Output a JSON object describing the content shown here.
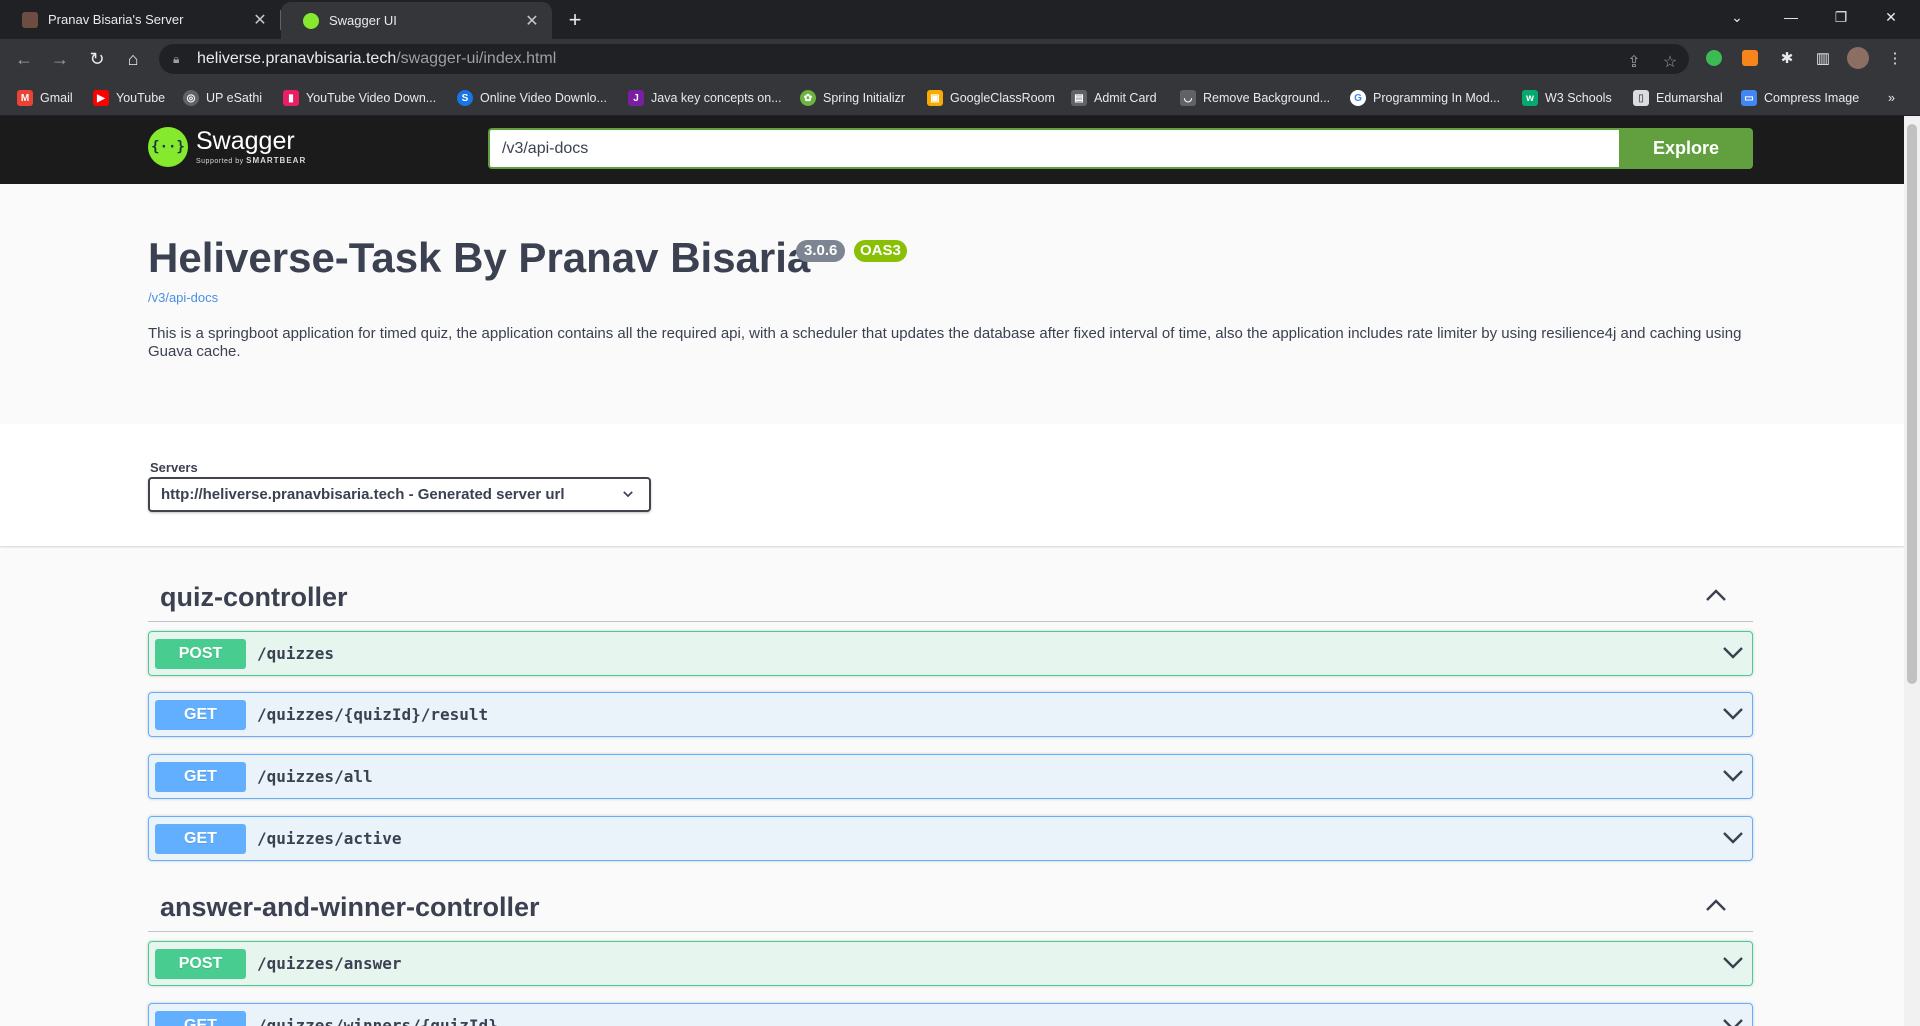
{
  "browser": {
    "tabs": [
      {
        "title": "Pranav Bisaria's Server",
        "active": false
      },
      {
        "title": "Swagger UI",
        "active": true
      }
    ],
    "url_host": "heliverse.pranavbisaria.tech",
    "url_path": "/swagger-ui/index.html",
    "bookmarks": [
      {
        "label": "Gmail",
        "icon": "gmail-icon",
        "color": "#ea4335"
      },
      {
        "label": "YouTube",
        "icon": "youtube-icon",
        "color": "#ff0000"
      },
      {
        "label": "UP eSathi",
        "icon": "globe-icon",
        "color": "#8ab4f8"
      },
      {
        "label": "YouTube Video Down...",
        "icon": "download-icon",
        "color": "#e91e63"
      },
      {
        "label": "Online Video Downlo...",
        "icon": "s-icon",
        "color": "#1a73e8"
      },
      {
        "label": "Java key concepts on...",
        "icon": "java-icon",
        "color": "#7b1fa2"
      },
      {
        "label": "Spring Initializr",
        "icon": "spring-icon",
        "color": "#6db33f"
      },
      {
        "label": "GoogleClassRoom",
        "icon": "classroom-icon",
        "color": "#f9ab00"
      },
      {
        "label": "Admit Card",
        "icon": "card-icon",
        "color": "#9aa0a6"
      },
      {
        "label": "Remove Background...",
        "icon": "remove-bg-icon",
        "color": "#9aa0a6"
      },
      {
        "label": "Programming In Mod...",
        "icon": "google-icon",
        "color": "#ffffff"
      },
      {
        "label": "W3 Schools",
        "icon": "w3-icon",
        "color": "#04aa6d"
      },
      {
        "label": "Edumarshal",
        "icon": "doc-icon",
        "color": "#dadce0"
      },
      {
        "label": "Compress Image",
        "icon": "image-icon",
        "color": "#4285f4"
      }
    ],
    "more_bookmarks": "»"
  },
  "swagger": {
    "brand": "Swagger",
    "brand_sub": "Supported by",
    "brand_sub_company": "SMARTBEAR",
    "spec_url": "/v3/api-docs",
    "explore_label": "Explore",
    "title": "Heliverse-Task By Pranav Bisaria",
    "version": "3.0.6",
    "oas": "OAS3",
    "spec_link": "/v3/api-docs",
    "description": "This is a springboot application for timed quiz, the application contains all the required api, with a scheduler that updates the database after fixed interval of time, also the application includes rate limiter by using resilience4j and caching using Guava cache.",
    "servers_label": "Servers",
    "server_selected": "http://heliverse.pranavbisaria.tech - Generated server url"
  },
  "tags": [
    {
      "name": "quiz-controller",
      "operations": [
        {
          "method": "POST",
          "path": "/quizzes"
        },
        {
          "method": "GET",
          "path": "/quizzes/{quizId}/result"
        },
        {
          "method": "GET",
          "path": "/quizzes/all"
        },
        {
          "method": "GET",
          "path": "/quizzes/active"
        }
      ]
    },
    {
      "name": "answer-and-winner-controller",
      "operations": [
        {
          "method": "POST",
          "path": "/quizzes/answer"
        },
        {
          "method": "GET",
          "path": "/quizzes/winners/{quizId}"
        }
      ]
    }
  ],
  "colors": {
    "post": "#49cc90",
    "get": "#61affe",
    "swagger_green": "#62a03f",
    "text": "#3b4151"
  }
}
